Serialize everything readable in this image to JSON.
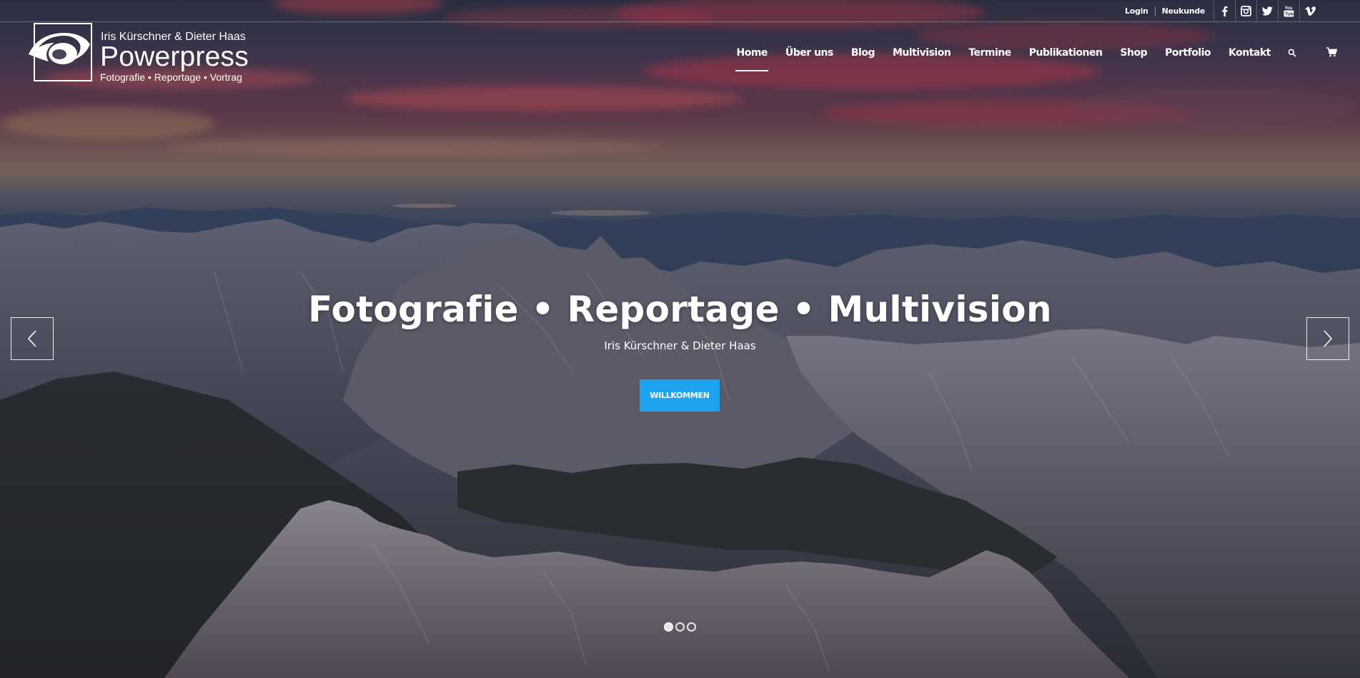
{
  "topbar": {
    "login": "Login",
    "register": "Neukunde",
    "social": [
      "facebook-icon",
      "instagram-icon",
      "twitter-icon",
      "youtube-icon",
      "vimeo-icon"
    ]
  },
  "logo": {
    "line1": "Iris Kürschner & Dieter Haas",
    "line2": "Powerpress",
    "line3": "Fotografie • Reportage • Vortrag"
  },
  "nav": {
    "items": [
      "Home",
      "Über uns",
      "Blog",
      "Multivision",
      "Termine",
      "Publikationen",
      "Shop",
      "Portfolio",
      "Kontakt"
    ],
    "active": "Home",
    "icons": [
      "search-icon",
      "cart-icon"
    ]
  },
  "slide": {
    "title": "Fotografie • Reportage • Multivision",
    "subtitle": "Iris Kürschner & Dieter Haas",
    "button": "WILLKOMMEN",
    "total_slides": 3,
    "current_slide": 1
  },
  "colors": {
    "accent": "#1ea3ef",
    "text": "#ffffff"
  }
}
